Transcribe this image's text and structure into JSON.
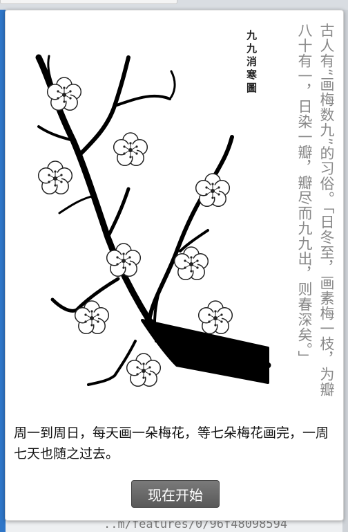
{
  "background": {
    "bottom_code_text": "..m/features/0/96f48098594"
  },
  "popup": {
    "painting_title": "九九消寒圖",
    "poem": "古人有“画梅数九”的习俗。「日冬至，画素梅一枝，为瓣八十有一，日染一瓣，瓣尽而九九出，则春深矣。」",
    "description": "周一到周日，每天画一朵梅花，等七朵梅花画完，一周七天也随之过去。",
    "start_button_label": "现在开始"
  },
  "colors": {
    "button": "#676767",
    "poem_text": "#888888",
    "branch": "#000000"
  }
}
